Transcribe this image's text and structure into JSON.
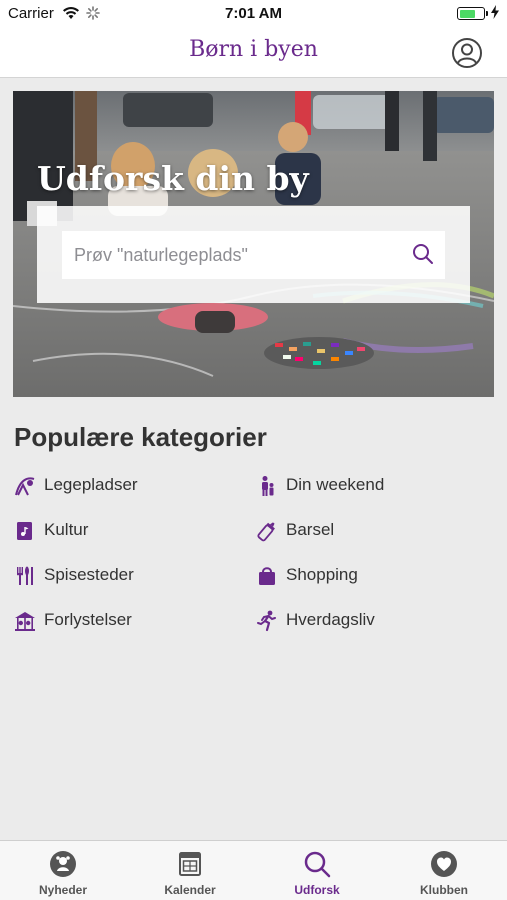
{
  "status": {
    "carrier": "Carrier",
    "time": "7:01 AM"
  },
  "nav": {
    "title": "Børn i byen"
  },
  "hero": {
    "title": "Udforsk din by",
    "search_placeholder": "Prøv \"naturlegeplads\""
  },
  "section": {
    "title": "Populære kategorier"
  },
  "categories": [
    {
      "label": "Legepladser",
      "icon": "playground-icon"
    },
    {
      "label": "Din weekend",
      "icon": "family-icon"
    },
    {
      "label": "Kultur",
      "icon": "music-book-icon"
    },
    {
      "label": "Barsel",
      "icon": "baby-bottle-icon"
    },
    {
      "label": "Spisesteder",
      "icon": "cutlery-icon"
    },
    {
      "label": "Shopping",
      "icon": "shopping-bag-icon"
    },
    {
      "label": "Forlystelser",
      "icon": "carousel-icon"
    },
    {
      "label": "Hverdagsliv",
      "icon": "running-person-icon"
    }
  ],
  "tabs": [
    {
      "label": "Nyheder",
      "icon": "news-icon",
      "active": false
    },
    {
      "label": "Kalender",
      "icon": "calendar-icon",
      "active": false
    },
    {
      "label": "Udforsk",
      "icon": "search-icon",
      "active": true
    },
    {
      "label": "Klubben",
      "icon": "heart-icon",
      "active": false
    }
  ],
  "colors": {
    "accent": "#6a2a8c",
    "background": "#ebebeb"
  }
}
